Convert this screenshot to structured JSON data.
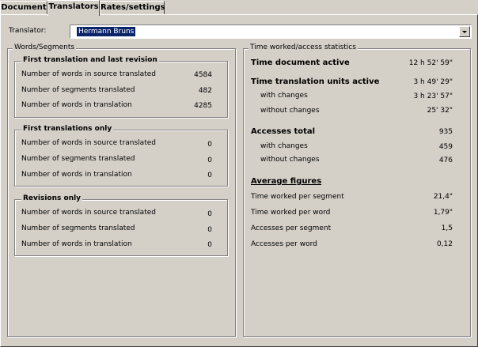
{
  "tabs": [
    "Document",
    "Translators",
    "Rates/settings"
  ],
  "translator": {
    "label": "Translator:",
    "value": "Hermann Bruns"
  },
  "words_segments": {
    "title": "Words/Segments",
    "groups": [
      {
        "title": "First translation and last revision",
        "rows": [
          {
            "label": "Number of words in source translated",
            "value": "4584"
          },
          {
            "label": "Number of segments translated",
            "value": "482"
          },
          {
            "label": "Number of words in translation",
            "value": "4285"
          }
        ]
      },
      {
        "title": "First translations only",
        "rows": [
          {
            "label": "Number of words in source translated",
            "value": "0"
          },
          {
            "label": "Number of segments translated",
            "value": "0"
          },
          {
            "label": "Number of words in translation",
            "value": "0"
          }
        ]
      },
      {
        "title": "Revisions only",
        "rows": [
          {
            "label": "Number of words in source translated",
            "value": "0"
          },
          {
            "label": "Number of segments translated",
            "value": "0"
          },
          {
            "label": "Number of words in translation",
            "value": "0"
          }
        ]
      }
    ]
  },
  "time_stats": {
    "title": "Time worked/access statistics",
    "time_document_active": {
      "label": "Time document active",
      "value": "12 h 52' 59\""
    },
    "time_units_active": {
      "label": "Time translation units active",
      "value": "3 h 49' 29\""
    },
    "units_with_changes": {
      "label": "with changes",
      "value": "3 h 23' 57\""
    },
    "units_without_changes": {
      "label": "without changes",
      "value": "25' 32\""
    },
    "accesses_total": {
      "label": "Accesses total",
      "value": "935"
    },
    "accesses_with_changes": {
      "label": "with changes",
      "value": "459"
    },
    "accesses_without_changes": {
      "label": "without changes",
      "value": "476"
    },
    "average_title": "Average figures",
    "time_per_segment": {
      "label": "Time worked per segment",
      "value": "21,4\""
    },
    "time_per_word": {
      "label": "Time worked per word",
      "value": "1,79\""
    },
    "accesses_per_segment": {
      "label": "Accesses per segment",
      "value": "1,5"
    },
    "accesses_per_word": {
      "label": "Accesses per word",
      "value": "0,12"
    }
  }
}
